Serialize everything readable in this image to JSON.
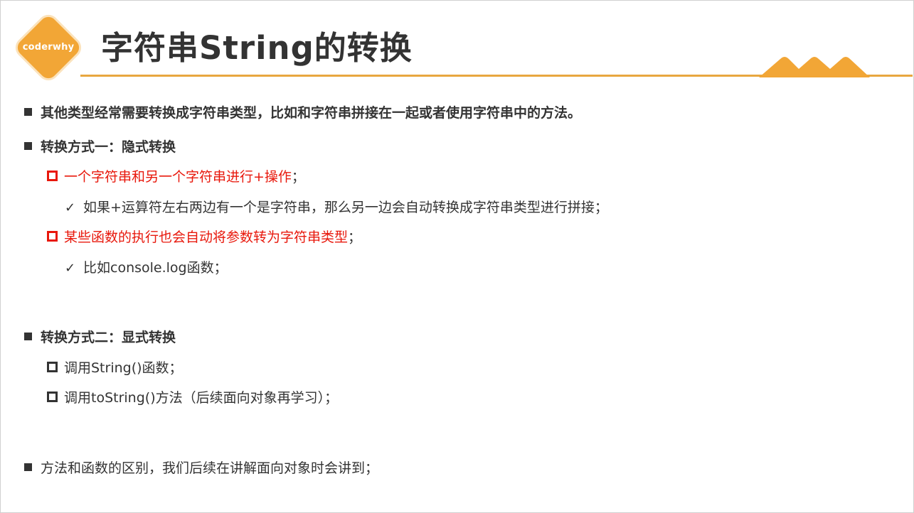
{
  "logo": {
    "text": "coderwhy"
  },
  "title": "字符串String的转换",
  "colors": {
    "accent": "#f2a636",
    "rule": "#e8a73f",
    "highlight": "#e8180c",
    "text": "#333333"
  },
  "items": {
    "p1": "其他类型经常需要转换成字符串类型，比如和字符串拼接在一起或者使用字符串中的方法。",
    "p2": "转换方式一：隐式转换",
    "p2a": "一个字符串和另一个字符串进行+操作",
    "p2a_end": "；",
    "p2a_1": "如果+运算符左右两边有一个是字符串，那么另一边会自动转换成字符串类型进行拼接；",
    "p2b": "某些函数的执行也会自动将参数转为字符串类型",
    "p2b_end": "；",
    "p2b_1": "比如console.log函数；",
    "p3": "转换方式二：显式转换",
    "p3a": "调用String()函数；",
    "p3b": "调用toString()方法（后续面向对象再学习）；",
    "p4": "方法和函数的区别，我们后续在讲解面向对象时会讲到；"
  },
  "icons": {
    "bullet": "filled-square-bullet",
    "sub_bullet": "hollow-square-bullet",
    "check": "check-mark"
  }
}
